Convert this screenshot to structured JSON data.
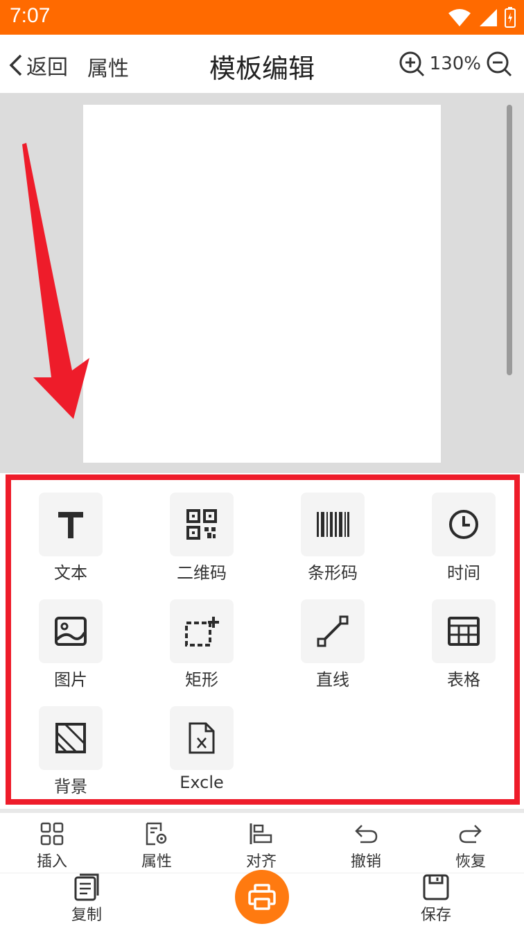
{
  "status": {
    "time": "7:07"
  },
  "appbar": {
    "back_label": "返回",
    "attr_label": "属性",
    "title": "模板编辑",
    "zoom": "130%"
  },
  "tools": [
    {
      "label": "文本",
      "icon": "text-icon"
    },
    {
      "label": "二维码",
      "icon": "qrcode-icon"
    },
    {
      "label": "条形码",
      "icon": "barcode-icon"
    },
    {
      "label": "时间",
      "icon": "clock-icon"
    },
    {
      "label": "图片",
      "icon": "image-icon"
    },
    {
      "label": "矩形",
      "icon": "rectangle-icon"
    },
    {
      "label": "直线",
      "icon": "line-icon"
    },
    {
      "label": "表格",
      "icon": "table-icon"
    },
    {
      "label": "背景",
      "icon": "background-icon"
    },
    {
      "label": "Excle",
      "icon": "excel-icon"
    }
  ],
  "bottom": {
    "row1": [
      {
        "label": "插入",
        "icon": "grid-icon"
      },
      {
        "label": "属性",
        "icon": "properties-icon"
      },
      {
        "label": "对齐",
        "icon": "align-icon"
      },
      {
        "label": "撤销",
        "icon": "undo-icon"
      },
      {
        "label": "恢复",
        "icon": "redo-icon"
      }
    ],
    "copy_label": "复制",
    "save_label": "保存"
  },
  "colors": {
    "accent": "#ff6a00",
    "highlight": "#ee1c2a",
    "canvas_bg": "#dcdcdc"
  }
}
